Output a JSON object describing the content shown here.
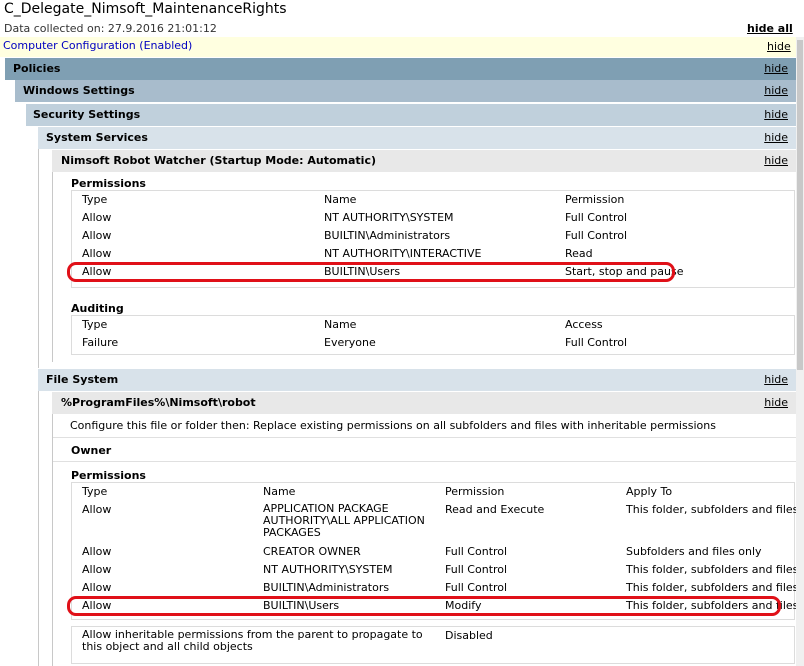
{
  "header": {
    "title": "C_Delegate_Nimsoft_MaintenanceRights",
    "collected": "Data collected on: 27.9.2016 21:01:12",
    "hide_all": "hide all"
  },
  "hide_label": "hide",
  "computer_config": "Computer Configuration (Enabled)",
  "policies": "Policies",
  "windows_settings": "Windows Settings",
  "security_settings": "Security Settings",
  "system_services": "System Services",
  "service": {
    "title": "Nimsoft Robot Watcher (Startup Mode: Automatic)",
    "permissions_heading": "Permissions",
    "perm_headers": [
      "Type",
      "Name",
      "Permission"
    ],
    "perm_rows": [
      [
        "Allow",
        "NT AUTHORITY\\SYSTEM",
        "Full Control"
      ],
      [
        "Allow",
        "BUILTIN\\Administrators",
        "Full Control"
      ],
      [
        "Allow",
        "NT AUTHORITY\\INTERACTIVE",
        "Read"
      ],
      [
        "Allow",
        "BUILTIN\\Users",
        "Start, stop and pause"
      ]
    ],
    "auditing_heading": "Auditing",
    "audit_headers": [
      "Type",
      "Name",
      "Access"
    ],
    "audit_rows": [
      [
        "Failure",
        "Everyone",
        "Full Control"
      ]
    ]
  },
  "file_system": "File System",
  "folder": {
    "path": "%ProgramFiles%\\Nimsoft\\robot",
    "configure_text": "Configure this file or folder then: Replace existing permissions on all subfolders and files with inheritable permissions",
    "owner_heading": "Owner",
    "permissions_heading": "Permissions",
    "perm_headers": [
      "Type",
      "Name",
      "Permission",
      "Apply To"
    ],
    "perm_rows": [
      [
        "Allow",
        "APPLICATION PACKAGE AUTHORITY\\ALL APPLICATION PACKAGES",
        "Read and Execute",
        "This folder, subfolders and files"
      ],
      [
        "Allow",
        "CREATOR OWNER",
        "Full Control",
        "Subfolders and files only"
      ],
      [
        "Allow",
        "NT AUTHORITY\\SYSTEM",
        "Full Control",
        "This folder, subfolders and files"
      ],
      [
        "Allow",
        "BUILTIN\\Administrators",
        "Full Control",
        "This folder, subfolders and files"
      ],
      [
        "Allow",
        "BUILTIN\\Users",
        "Modify",
        "This folder, subfolders and files"
      ]
    ],
    "inherit_label": "Allow inheritable permissions from the parent to propagate to this object and all child objects",
    "inherit_value": "Disabled"
  },
  "highlight_color": "#e01018"
}
